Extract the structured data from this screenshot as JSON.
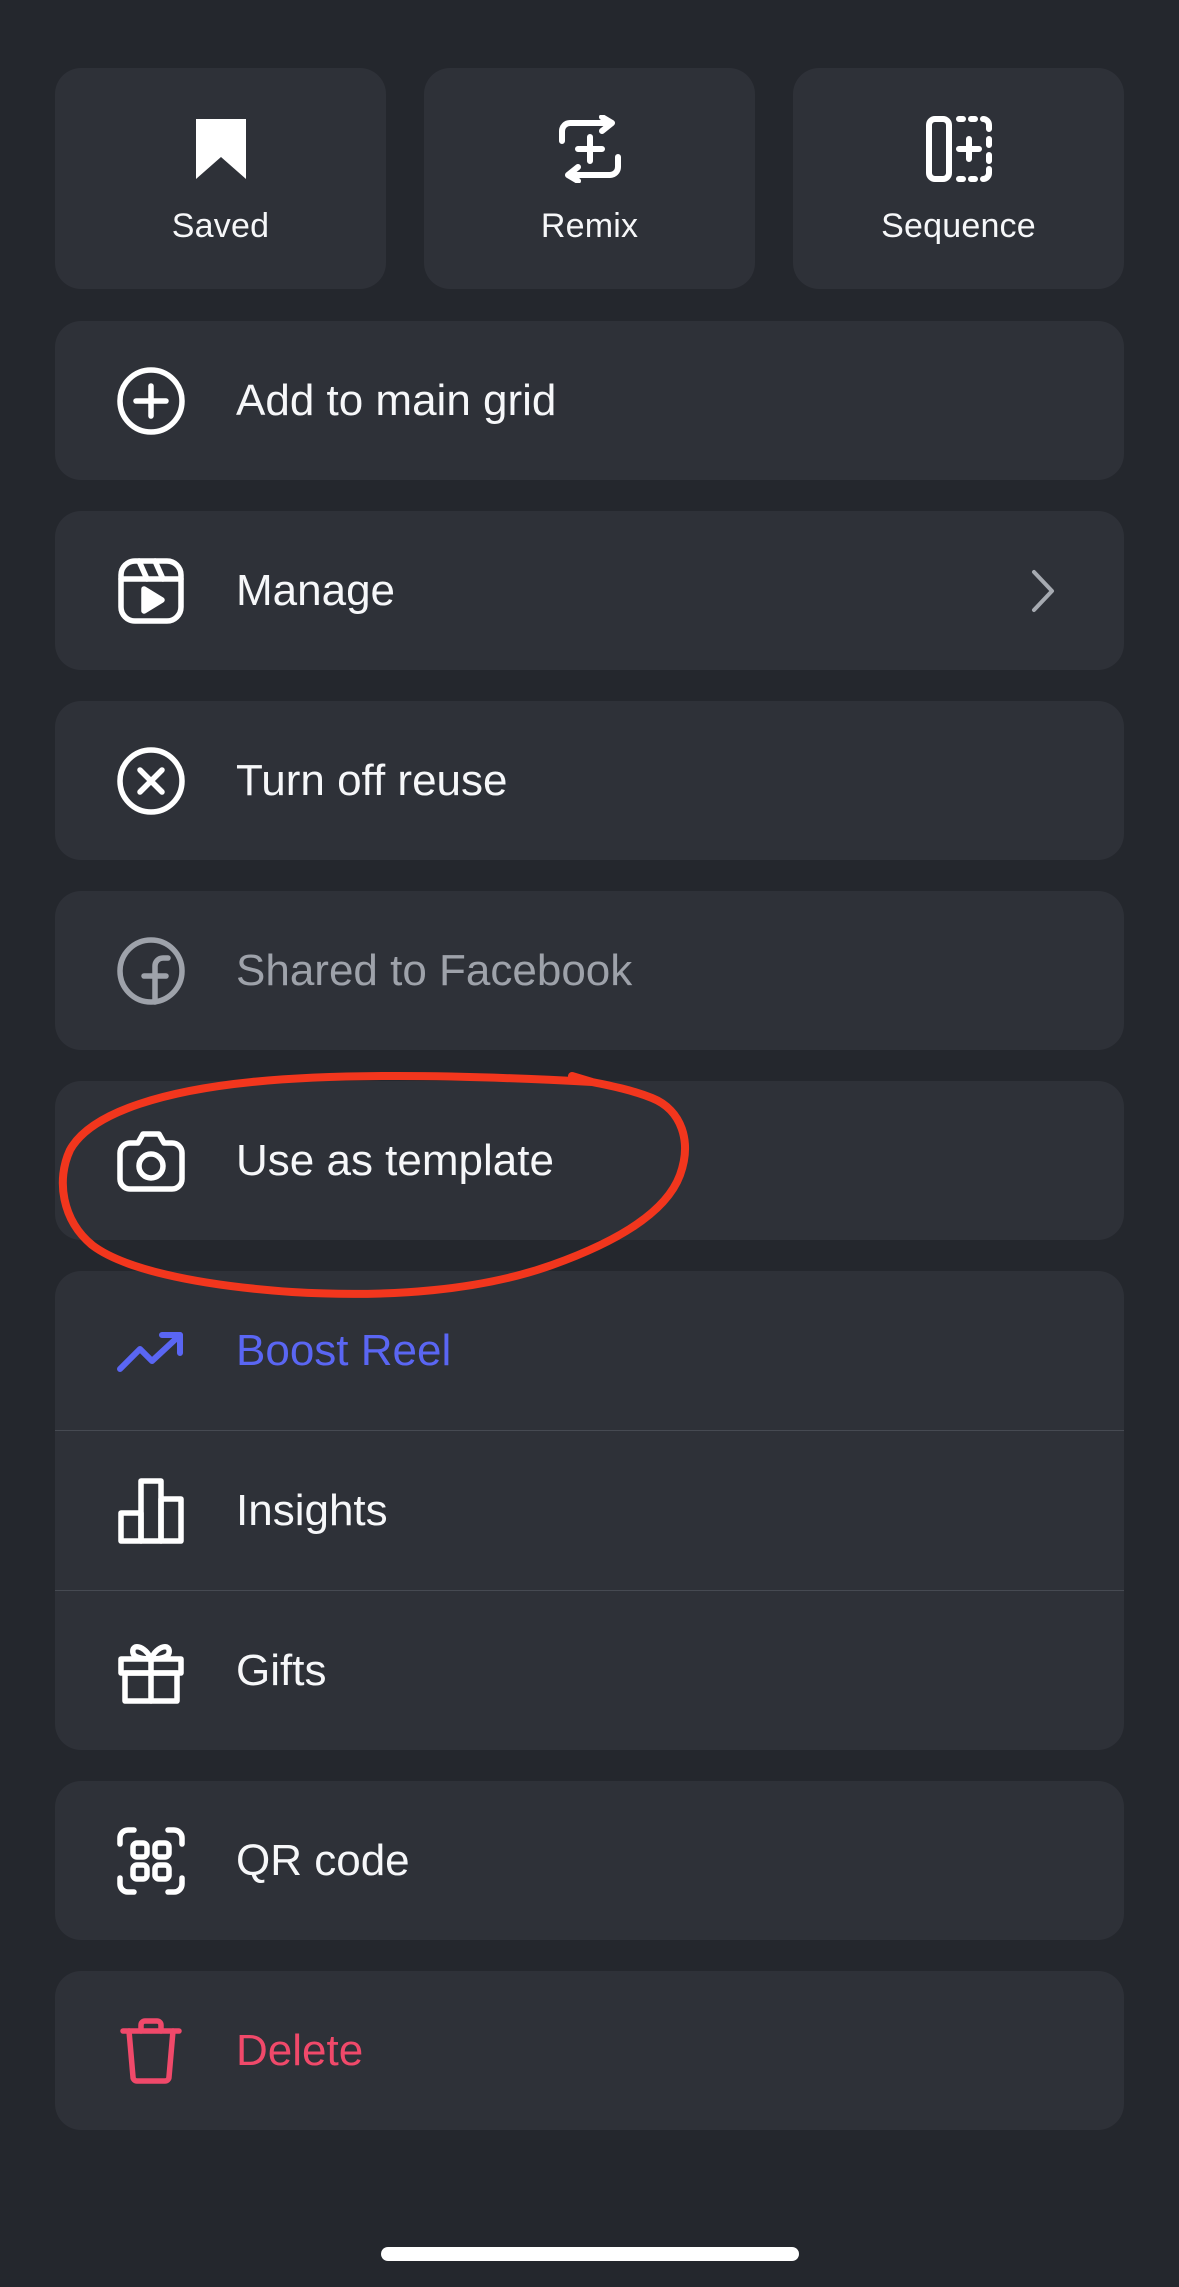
{
  "top_actions": [
    {
      "label": "Saved",
      "icon": "bookmark-icon"
    },
    {
      "label": "Remix",
      "icon": "remix-icon"
    },
    {
      "label": "Sequence",
      "icon": "sequence-icon"
    }
  ],
  "menu": {
    "add_to_grid": {
      "label": "Add to main grid",
      "icon": "plus-circle-icon"
    },
    "manage": {
      "label": "Manage",
      "icon": "reel-icon"
    },
    "turn_off_reuse": {
      "label": "Turn off reuse",
      "icon": "x-circle-icon"
    },
    "shared_facebook": {
      "label": "Shared to Facebook",
      "icon": "facebook-icon"
    },
    "use_as_template": {
      "label": "Use as template",
      "icon": "camera-icon"
    },
    "boost_reel": {
      "label": "Boost Reel",
      "icon": "trending-up-icon"
    },
    "insights": {
      "label": "Insights",
      "icon": "bar-chart-icon"
    },
    "gifts": {
      "label": "Gifts",
      "icon": "gift-icon"
    },
    "qr_code": {
      "label": "QR code",
      "icon": "qr-code-icon"
    },
    "delete": {
      "label": "Delete",
      "icon": "trash-icon"
    }
  },
  "colors": {
    "background": "#24272d",
    "card": "#2e3138",
    "text": "#f6f7f9",
    "muted": "#9ea2aa",
    "boost": "#5a66f3",
    "danger": "#f0496a",
    "annotation": "#f2361d"
  }
}
